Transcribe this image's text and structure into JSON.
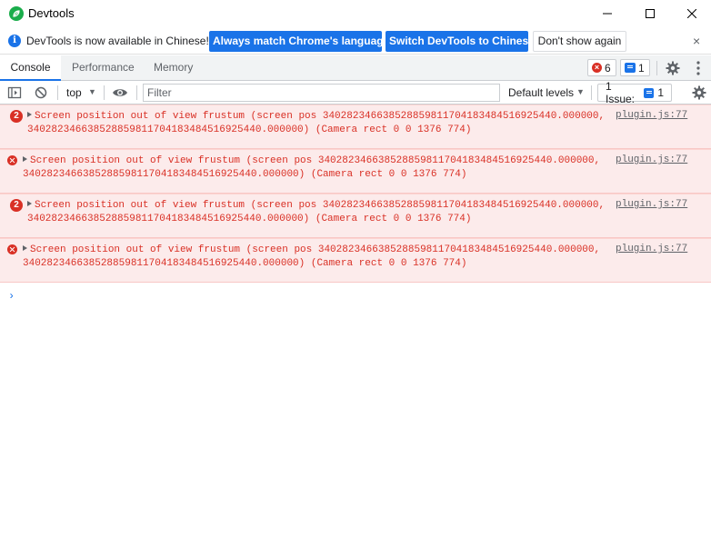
{
  "window": {
    "title": "Devtools",
    "app_icon": "devtools-leaf-icon",
    "controls": [
      "minimize-icon",
      "maximize-icon",
      "close-icon"
    ]
  },
  "infobar": {
    "message": "DevTools is now available in Chinese!",
    "primary_button_1": "Always match Chrome's language",
    "primary_button_2": "Switch DevTools to Chinese",
    "secondary_button": "Don't show again",
    "close": "×"
  },
  "tabs": [
    {
      "label": "Console",
      "active": true
    },
    {
      "label": "Performance",
      "active": false
    },
    {
      "label": "Memory",
      "active": false
    }
  ],
  "counters": {
    "errors": "6",
    "issues": "1"
  },
  "toolbar": {
    "context": "top",
    "filter_placeholder": "Filter",
    "levels": "Default levels",
    "issues_label": "1 Issue:",
    "issues_count": "1"
  },
  "messages": [
    {
      "count": "2",
      "line1": "Screen position out of view frustum (screen pos 340282346638528859811704183484516925440.000000,",
      "line2": "340282346638528859811704183484516925440.000000) (Camera rect 0 0 1376 774)",
      "source": "plugin.js:77"
    },
    {
      "count": "",
      "line1": "Screen position out of view frustum (screen pos 340282346638528859811704183484516925440.000000,",
      "line2": "340282346638528859811704183484516925440.000000) (Camera rect 0 0 1376 774)",
      "source": "plugin.js:77"
    },
    {
      "count": "2",
      "line1": "Screen position out of view frustum (screen pos 340282346638528859811704183484516925440.000000,",
      "line2": "340282346638528859811704183484516925440.000000) (Camera rect 0 0 1376 774)",
      "source": "plugin.js:77"
    },
    {
      "count": "",
      "line1": "Screen position out of view frustum (screen pos 340282346638528859811704183484516925440.000000,",
      "line2": "340282346638528859811704183484516925440.000000) (Camera rect 0 0 1376 774)",
      "source": "plugin.js:77"
    }
  ],
  "prompt": "›",
  "colors": {
    "accent": "#1a73e8",
    "error": "#d93025",
    "error_bg": "#fcebeb"
  }
}
